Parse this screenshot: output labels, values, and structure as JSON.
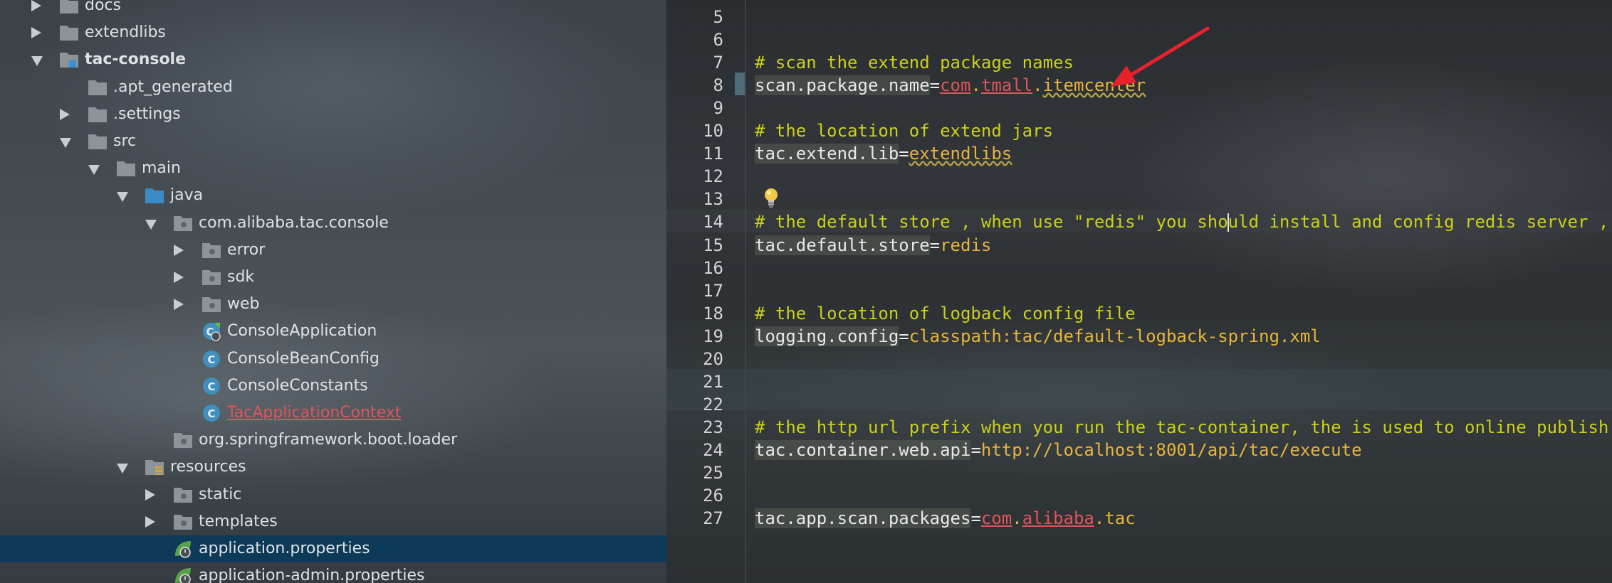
{
  "project_tree": {
    "nodes": [
      {
        "label": "docs",
        "expander": "right",
        "icon": "folder-icon",
        "style": "normal"
      },
      {
        "label": "extendlibs",
        "expander": "right",
        "icon": "folder-icon",
        "style": "normal"
      },
      {
        "label": "tac-console",
        "expander": "down",
        "icon": "module-folder-icon",
        "style": "bold"
      },
      {
        "label": ".apt_generated",
        "expander": "none",
        "icon": "folder-icon",
        "style": "normal"
      },
      {
        "label": ".settings",
        "expander": "right",
        "icon": "folder-icon",
        "style": "normal"
      },
      {
        "label": "src",
        "expander": "down",
        "icon": "folder-icon",
        "style": "normal"
      },
      {
        "label": "main",
        "expander": "down",
        "icon": "folder-icon",
        "style": "normal"
      },
      {
        "label": "java",
        "expander": "down",
        "icon": "source-folder-icon",
        "style": "normal"
      },
      {
        "label": "com.alibaba.tac.console",
        "expander": "down",
        "icon": "package-icon",
        "style": "normal"
      },
      {
        "label": "error",
        "expander": "right",
        "icon": "package-icon",
        "style": "normal"
      },
      {
        "label": "sdk",
        "expander": "right",
        "icon": "package-icon",
        "style": "normal"
      },
      {
        "label": "web",
        "expander": "right",
        "icon": "package-icon",
        "style": "normal"
      },
      {
        "label": "ConsoleApplication",
        "expander": "none",
        "icon": "spring-boot-class-icon",
        "style": "normal"
      },
      {
        "label": "ConsoleBeanConfig",
        "expander": "none",
        "icon": "class-icon",
        "style": "normal"
      },
      {
        "label": "ConsoleConstants",
        "expander": "none",
        "icon": "class-icon",
        "style": "normal"
      },
      {
        "label": "TacApplicationContext",
        "expander": "none",
        "icon": "class-icon",
        "style": "error"
      },
      {
        "label": "org.springframework.boot.loader",
        "expander": "none",
        "icon": "package-icon",
        "style": "normal"
      },
      {
        "label": "resources",
        "expander": "down",
        "icon": "resources-folder-icon",
        "style": "normal"
      },
      {
        "label": "static",
        "expander": "right",
        "icon": "package-icon",
        "style": "normal"
      },
      {
        "label": "templates",
        "expander": "right",
        "icon": "package-icon",
        "style": "normal"
      },
      {
        "label": "application.properties",
        "expander": "none",
        "icon": "spring-properties-icon",
        "style": "selected"
      },
      {
        "label": "application-admin.properties",
        "expander": "none",
        "icon": "spring-properties-icon",
        "style": "normal"
      }
    ]
  },
  "editor": {
    "lines": [
      {
        "n": "5",
        "tokens": []
      },
      {
        "n": "6",
        "tokens": []
      },
      {
        "n": "7",
        "tokens": [
          {
            "t": "# scan the extend package names",
            "c": "cmt"
          }
        ]
      },
      {
        "n": "8",
        "tokens": [
          {
            "t": "scan.package.name",
            "c": "key"
          },
          {
            "t": "=",
            "c": "eq"
          },
          {
            "t": "com",
            "c": "err"
          },
          {
            "t": ".",
            "c": "val"
          },
          {
            "t": "tmall",
            "c": "err"
          },
          {
            "t": ".",
            "c": "val"
          },
          {
            "t": "itemcenter",
            "c": "val wavy"
          }
        ]
      },
      {
        "n": "9",
        "tokens": []
      },
      {
        "n": "10",
        "tokens": [
          {
            "t": "# the location of extend jars",
            "c": "cmt"
          }
        ]
      },
      {
        "n": "11",
        "tokens": [
          {
            "t": "tac.extend.lib",
            "c": "key"
          },
          {
            "t": "=",
            "c": "eq"
          },
          {
            "t": "extendlibs",
            "c": "val wavy"
          }
        ]
      },
      {
        "n": "12",
        "tokens": []
      },
      {
        "n": "13",
        "tokens": []
      },
      {
        "n": "14",
        "tokens": [
          {
            "t": "# the default store , when use \"redis\" you sho",
            "c": "cmt"
          },
          {
            "t": "",
            "c": "caret"
          },
          {
            "t": "uld install and config redis server , us",
            "c": "cmt"
          }
        ]
      },
      {
        "n": "15",
        "tokens": [
          {
            "t": "tac.default.store",
            "c": "key"
          },
          {
            "t": "=",
            "c": "eq"
          },
          {
            "t": "redis",
            "c": "val"
          }
        ]
      },
      {
        "n": "16",
        "tokens": []
      },
      {
        "n": "17",
        "tokens": []
      },
      {
        "n": "18",
        "tokens": [
          {
            "t": "# the location of logback config file",
            "c": "cmt"
          }
        ]
      },
      {
        "n": "19",
        "tokens": [
          {
            "t": "logging.config",
            "c": "key"
          },
          {
            "t": "=",
            "c": "eq"
          },
          {
            "t": "classpath:tac/default-logback-spring.xml",
            "c": "val"
          }
        ]
      },
      {
        "n": "20",
        "tokens": []
      },
      {
        "n": "21",
        "tokens": []
      },
      {
        "n": "22",
        "tokens": []
      },
      {
        "n": "23",
        "tokens": [
          {
            "t": "# the http url prefix when you run the tac-container, the is used to online publish ch",
            "c": "cmt"
          }
        ]
      },
      {
        "n": "24",
        "tokens": [
          {
            "t": "tac.container.web.api",
            "c": "key"
          },
          {
            "t": "=",
            "c": "eq"
          },
          {
            "t": "http://localhost:8001/api/tac/execute",
            "c": "val"
          }
        ]
      },
      {
        "n": "25",
        "tokens": []
      },
      {
        "n": "26",
        "tokens": []
      },
      {
        "n": "27",
        "tokens": [
          {
            "t": "tac.app.scan.packages",
            "c": "key"
          },
          {
            "t": "=",
            "c": "eq"
          },
          {
            "t": "com",
            "c": "err"
          },
          {
            "t": ".",
            "c": "val"
          },
          {
            "t": "alibaba",
            "c": "err"
          },
          {
            "t": ".",
            "c": "val"
          },
          {
            "t": "tac",
            "c": "val"
          }
        ]
      }
    ]
  },
  "icons": {
    "intention_bulb": "lightbulb-icon",
    "annotation": "red-arrow-annotation"
  },
  "colors": {
    "comment": "#ccd01a",
    "property_key": "#e6e8ea",
    "property_value": "#e8b53c",
    "error": "#e0555b",
    "selection": "#0e3a5a",
    "annotation_arrow": "#e8222c"
  }
}
